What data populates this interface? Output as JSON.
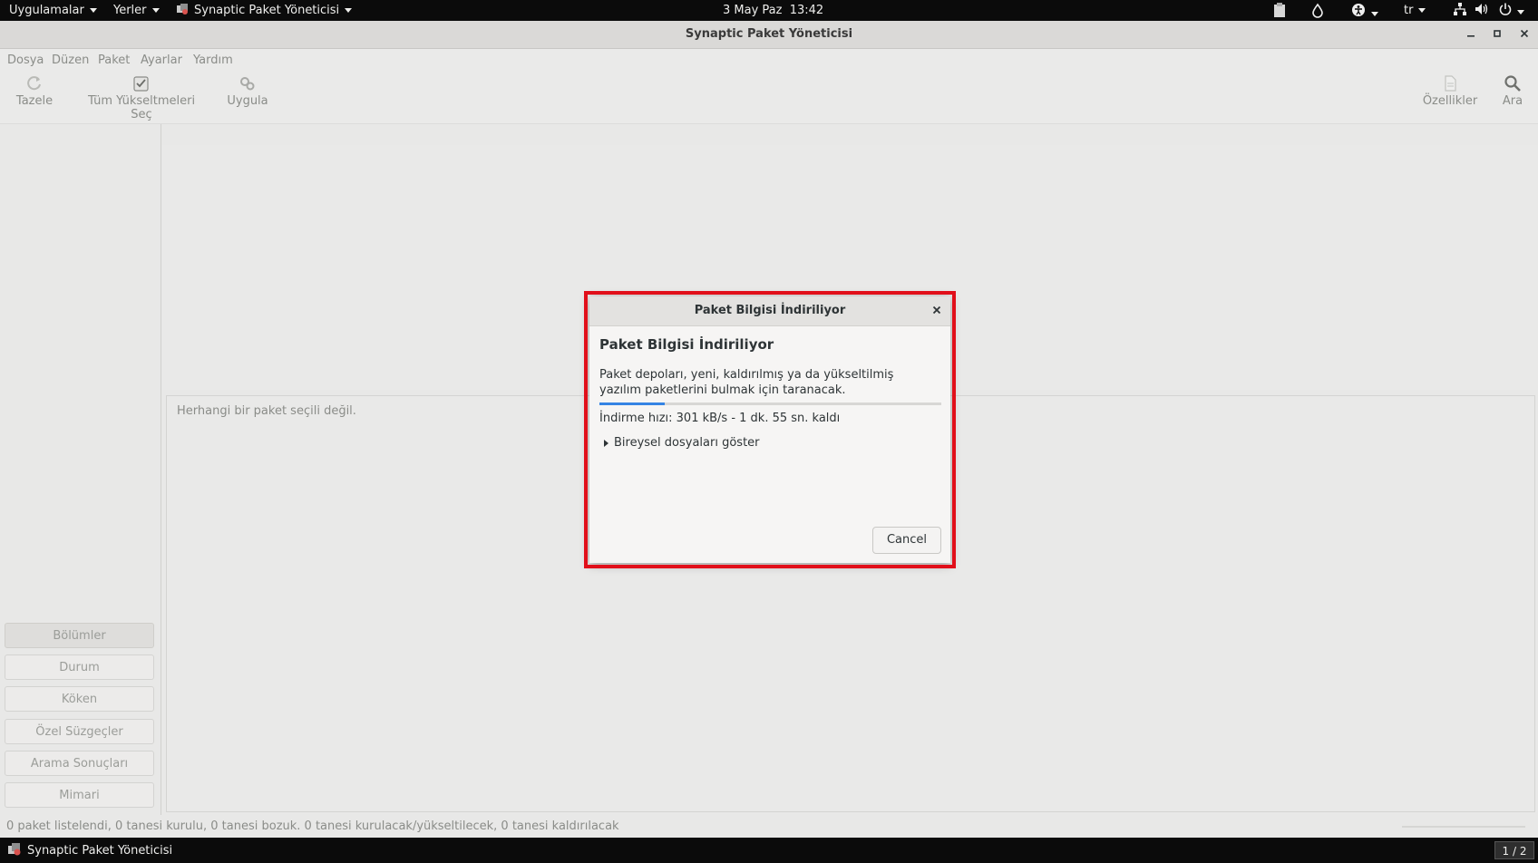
{
  "topbar": {
    "apps": "Uygulamalar",
    "places": "Yerler",
    "current_app": "Synaptic Paket Yöneticisi",
    "clock": "3 May Paz  13:42",
    "lang": "tr"
  },
  "window": {
    "title": "Synaptic Paket Yöneticisi"
  },
  "menu": {
    "file": "Dosya",
    "edit": "Düzen",
    "package": "Paket",
    "settings": "Ayarlar",
    "help": "Yardım"
  },
  "toolbar": {
    "reload": "Tazele",
    "mark_all_upgrades": "Tüm Yükseltmeleri Seç",
    "apply": "Uygula",
    "properties": "Özellikler",
    "search": "Ara"
  },
  "filters": [
    "Bölümler",
    "Durum",
    "Köken",
    "Özel Süzgeçler",
    "Arama Sonuçları",
    "Mimari"
  ],
  "details": {
    "empty_text": "Herhangi bir paket seçili değil."
  },
  "statusbar": {
    "text": "0 paket listelendi, 0 tanesi kurulu, 0 tanesi bozuk. 0 tanesi kurulacak/yükseltilecek, 0 tanesi kaldırılacak"
  },
  "taskbar": {
    "app": "Synaptic Paket Yöneticisi",
    "workspace": "1 / 2"
  },
  "dialog": {
    "title": "Paket Bilgisi İndiriliyor",
    "heading": "Paket Bilgisi İndiriliyor",
    "description": "Paket depoları, yeni, kaldırılmış ya da yükseltilmiş yazılım paketlerini bulmak için taranacak.",
    "progress": 0.19,
    "speed": "İndirme hızı: 301 kB/s - 1 dk. 55 sn. kaldı",
    "expander": "Bireysel dosyaları göster",
    "cancel": "Cancel"
  },
  "colors": {
    "highlight": "#e10f1a",
    "progress": "#3584e4"
  }
}
